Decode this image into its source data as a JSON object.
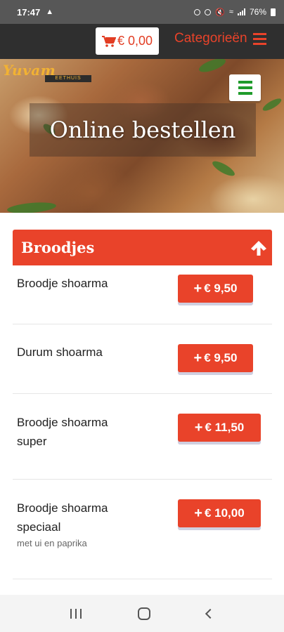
{
  "status_bar": {
    "time": "17:47",
    "battery": "76%",
    "icons": [
      "notification-icon",
      "nfc-icon",
      "alarm-icon",
      "mute-icon",
      "wifi-icon",
      "signal-icon",
      "battery-icon"
    ]
  },
  "nav": {
    "cart_total": "€ 0,00",
    "categories_label": "Categorieën"
  },
  "hero": {
    "logo_text": "Yuvam",
    "logo_sub": "EETHUIS",
    "title": "Online bestellen"
  },
  "category": {
    "title": "Broodjes",
    "items": [
      {
        "name": "Broodje shoarma",
        "price": "€ 9,50",
        "description": ""
      },
      {
        "name": "Durum shoarma",
        "price": "€ 9,50",
        "description": ""
      },
      {
        "name": "Broodje shoarma super",
        "price": "€ 11,50",
        "description": ""
      },
      {
        "name": "Broodje shoarma speciaal",
        "price": "€ 10,00",
        "description": "met ui en paprika"
      }
    ]
  },
  "colors": {
    "accent": "#e9432a",
    "nav_bg": "#2f2f2f",
    "menu_green": "#1f9b2b"
  }
}
